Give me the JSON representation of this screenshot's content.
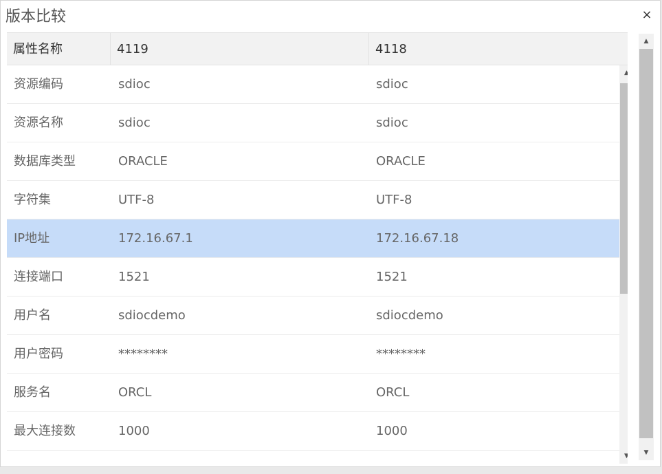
{
  "dialog": {
    "title": "版本比较",
    "close_label": "×"
  },
  "table": {
    "columns": [
      "属性名称",
      "4119",
      "4118"
    ],
    "rows": [
      {
        "name": "资源编码",
        "v1": "sdioc",
        "v2": "sdioc"
      },
      {
        "name": "资源名称",
        "v1": "sdioc",
        "v2": "sdioc"
      },
      {
        "name": "数据库类型",
        "v1": "ORACLE",
        "v2": "ORACLE"
      },
      {
        "name": "字符集",
        "v1": "UTF-8",
        "v2": "UTF-8"
      },
      {
        "name": "IP地址",
        "v1": "172.16.67.1",
        "v2": "172.16.67.18"
      },
      {
        "name": "连接端口",
        "v1": "1521",
        "v2": "1521"
      },
      {
        "name": "用户名",
        "v1": "sdiocdemo",
        "v2": "sdiocdemo"
      },
      {
        "name": "用户密码",
        "v1": "********",
        "v2": "********"
      },
      {
        "name": "服务名",
        "v1": "ORCL",
        "v2": "ORCL"
      },
      {
        "name": "最大连接数",
        "v1": "1000",
        "v2": "1000"
      }
    ],
    "selected_row": 4
  },
  "scrollbar": {
    "up_arrow": "▲",
    "down_arrow": "▼"
  },
  "colors": {
    "selected_row_bg": "#c6dcf9",
    "header_bg": "#f2f2f2"
  }
}
